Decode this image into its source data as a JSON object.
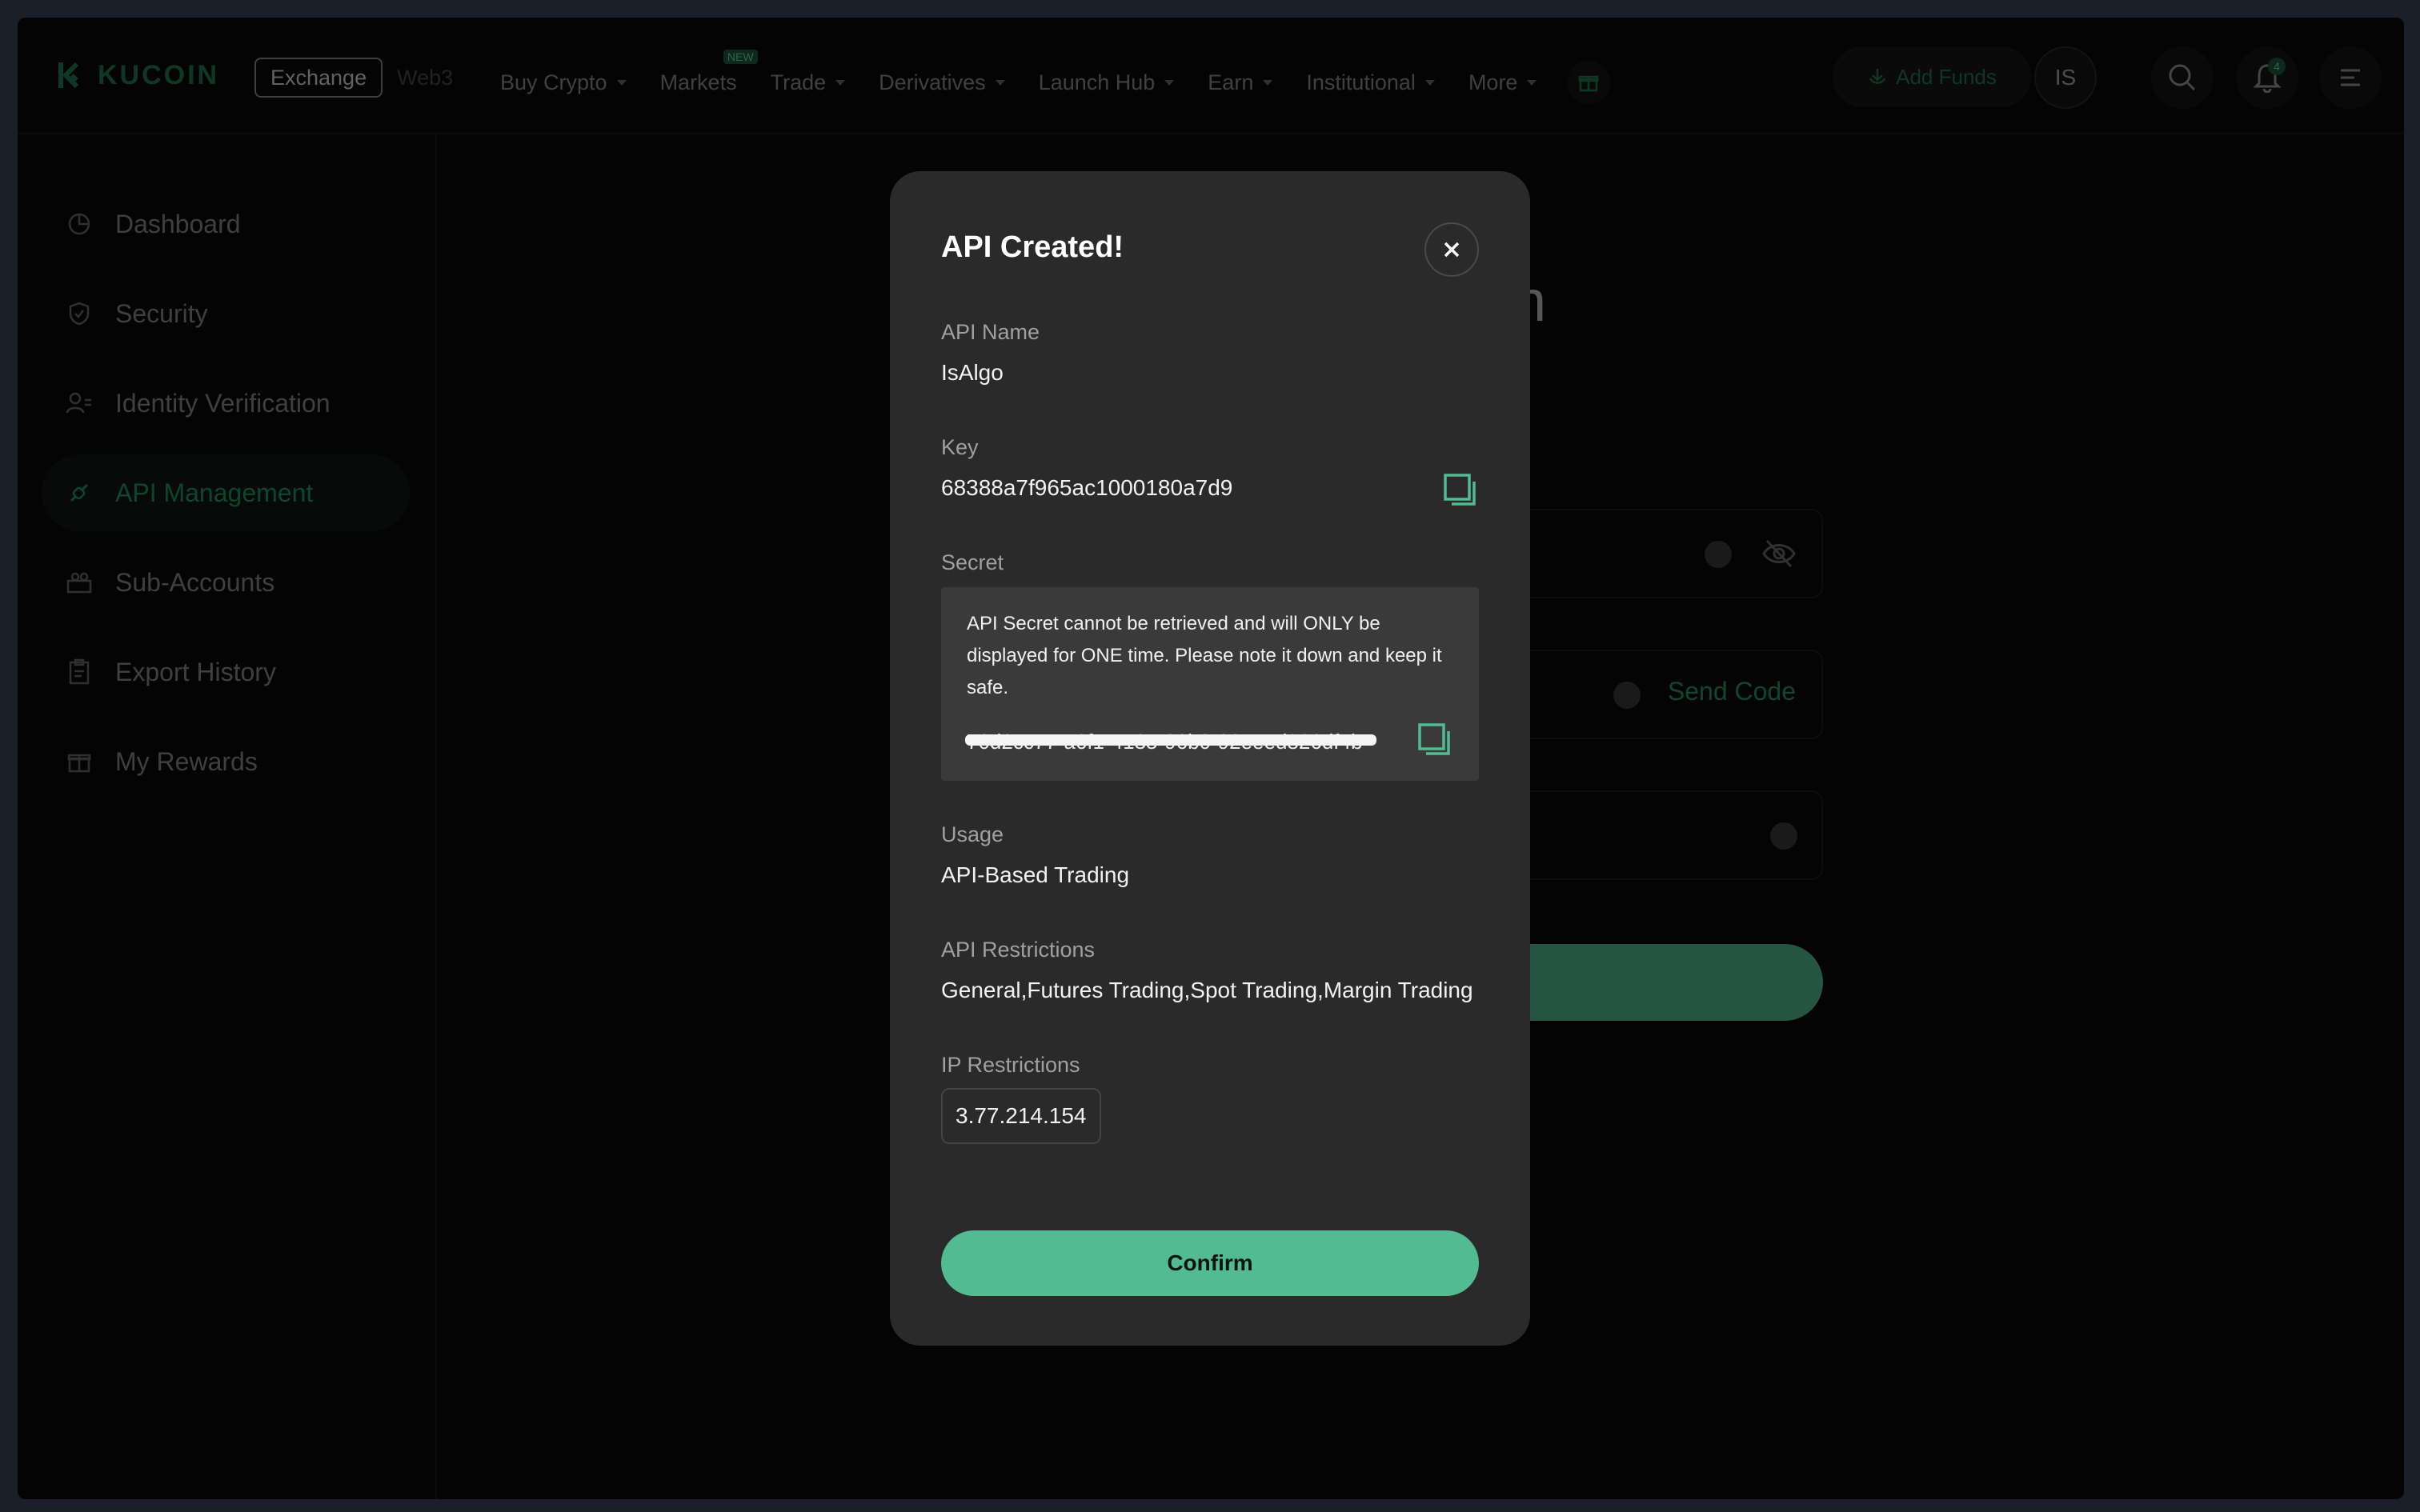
{
  "header": {
    "brand": "KUCOIN",
    "toggle": {
      "exchange": "Exchange",
      "web3": "Web3"
    },
    "nav": [
      {
        "label": "Buy Crypto",
        "caret": true
      },
      {
        "label": "Markets",
        "caret": false,
        "badge": "NEW"
      },
      {
        "label": "Trade",
        "caret": true
      },
      {
        "label": "Derivatives",
        "caret": true
      },
      {
        "label": "Launch Hub",
        "caret": true
      },
      {
        "label": "Earn",
        "caret": true
      },
      {
        "label": "Institutional",
        "caret": true
      },
      {
        "label": "More",
        "caret": true
      }
    ],
    "add_funds": "Add Funds",
    "avatar_initials": "IS",
    "notification_count": "4",
    "icons": [
      "gift-icon",
      "download-icon",
      "search-icon",
      "bell-icon",
      "menu-icon"
    ]
  },
  "sidebar": {
    "items": [
      {
        "label": "Dashboard",
        "icon": "pie-chart-icon",
        "active": false
      },
      {
        "label": "Security",
        "icon": "shield-icon",
        "active": false
      },
      {
        "label": "Identity Verification",
        "icon": "user-id-icon",
        "active": false
      },
      {
        "label": "API Management",
        "icon": "api-link-icon",
        "active": true
      },
      {
        "label": "Sub-Accounts",
        "icon": "sub-accounts-icon",
        "active": false
      },
      {
        "label": "Export History",
        "icon": "clipboard-icon",
        "active": false
      },
      {
        "label": "My Rewards",
        "icon": "gift-icon",
        "active": false
      }
    ]
  },
  "background": {
    "title_fragment": "n",
    "send_code": "Send Code"
  },
  "modal": {
    "title": "API Created!",
    "api_name_label": "API Name",
    "api_name": "IsAlgo",
    "key_label": "Key",
    "key": "68388a7f965ac1000180a7d9",
    "secret_label": "Secret",
    "secret_note": "API Secret cannot be retrieved and will ONLY be displayed for ONE time. Please note it down and keep it safe.",
    "secret_value": "70d2cc77-a6f1-4135-96b0-92eeed826df4b",
    "usage_label": "Usage",
    "usage": "API-Based Trading",
    "restrictions_label": "API Restrictions",
    "restrictions": "General,Futures Trading,Spot Trading,Margin Trading",
    "ip_label": "IP Restrictions",
    "ip": "3.77.214.154",
    "confirm": "Confirm"
  },
  "colors": {
    "accent": "#53bb92",
    "brand_green": "#1f7a55",
    "modal_bg": "#2a2a2a",
    "page_bg": "#0b0b0b"
  }
}
